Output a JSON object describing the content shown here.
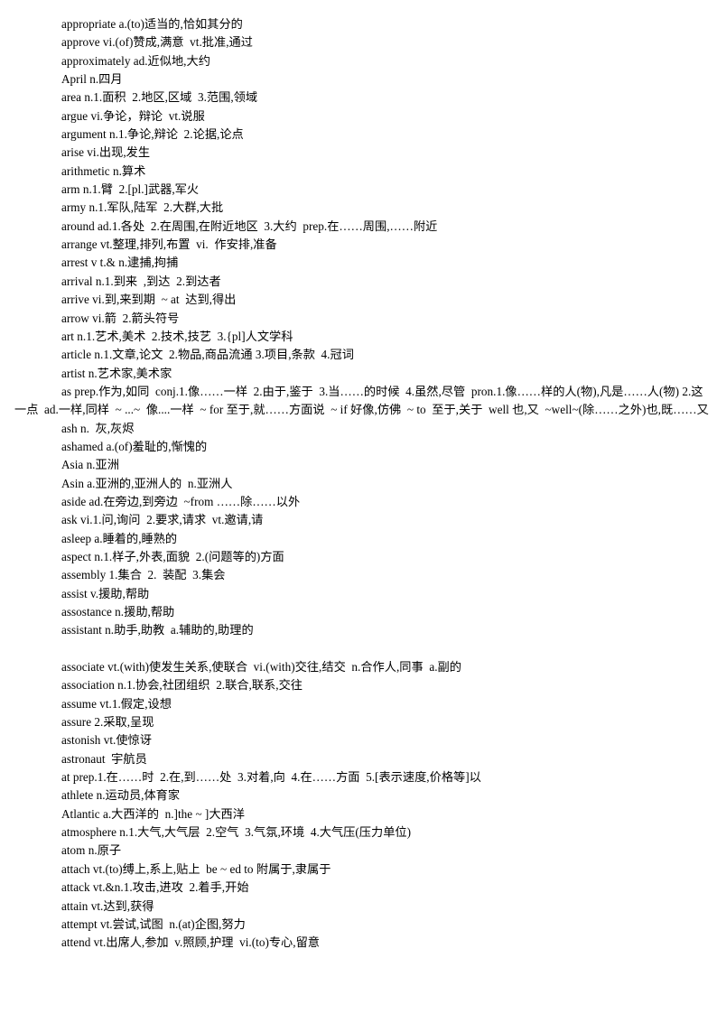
{
  "document": {
    "kind": "vocabulary-glossary-page",
    "language_pair": "English-Chinese",
    "entries": [
      {
        "text": "appropriate a.(to)适当的,恰如其分的"
      },
      {
        "text": "approve vi.(of)赞成,满意  vt.批准,通过"
      },
      {
        "text": "approximately ad.近似地,大约"
      },
      {
        "text": "April n.四月"
      },
      {
        "text": "area n.1.面积  2.地区,区域  3.范围,领域"
      },
      {
        "text": "argue vi.争论，辩论  vt.说服"
      },
      {
        "text": "argument n.1.争论,辩论  2.论据,论点"
      },
      {
        "text": "arise vi.出现,发生"
      },
      {
        "text": "arithmetic n.算术"
      },
      {
        "text": "arm n.1.臂  2.[pl.]武器,军火"
      },
      {
        "text": "army n.1.军队,陆军  2.大群,大批"
      },
      {
        "text": "around ad.1.各处  2.在周围,在附近地区  3.大约  prep.在……周围,……附近"
      },
      {
        "text": "arrange vt.整理,排列,布置  vi.  作安排,准备"
      },
      {
        "text": "arrest v t.& n.逮捕,拘捕"
      },
      {
        "text": "arrival n.1.到来  ,到达  2.到达者"
      },
      {
        "text": "arrive vi.到,来到期  ~ at  达到,得出"
      },
      {
        "text": "arrow vi.箭  2.箭头符号"
      },
      {
        "text": "art n.1.艺术,美术  2.技术,技艺  3.{pl]人文学科"
      },
      {
        "text": "article n.1.文章,论文  2.物品,商品流通 3.项目,条款  4.冠词"
      },
      {
        "text": "artist n.艺术家,美术家"
      },
      {
        "text": "as prep.作为,如同  conj.1.像……一样  2.由于,鉴于  3.当……的时候  4.虽然,尽管  pron.1.像……样的人(物),凡是……人(物) 2.这一点  ad.一样,同样  ~ ...~  像....一样  ~ for 至于,就……方面说  ~ if 好像,仿佛  ~ to  至于,关于  well 也,又  ~well~(除……之外)也,既……又"
      },
      {
        "text": "ash n.  灰,灰烬"
      },
      {
        "text": "ashamed a.(of)羞耻的,惭愧的"
      },
      {
        "text": "Asia n.亚洲"
      },
      {
        "text": "Asin a.亚洲的,亚洲人的  n.亚洲人"
      },
      {
        "text": "aside ad.在旁边,到旁边  ~from ……除……以外"
      },
      {
        "text": "ask vi.1.问,询问  2.要求,请求  vt.邀请,请"
      },
      {
        "text": "asleep a.睡着的,睡熟的"
      },
      {
        "text": "aspect n.1.样子,外表,面貌  2.(问题等的)方面"
      },
      {
        "text": "assembly 1.集合  2.  装配  3.集会"
      },
      {
        "text": "assist v.援助,帮助"
      },
      {
        "text": "assostance n.援助,帮助"
      },
      {
        "text": "assistant n.助手,助教  a.辅助的,助理的",
        "gap_after": true
      },
      {
        "text": "associate vt.(with)使发生关系,使联合  vi.(with)交往,结交  n.合作人,同事  a.副的"
      },
      {
        "text": "association n.1.协会,社团组织  2.联合,联系,交往"
      },
      {
        "text": "assume vt.1.假定,设想"
      },
      {
        "text": "assure 2.采取,呈现"
      },
      {
        "text": "astonish vt.使惊讶"
      },
      {
        "text": "astronaut  宇航员"
      },
      {
        "text": "at prep.1.在……时  2.在,到……处  3.对着,向  4.在……方面  5.[表示速度,价格等]以"
      },
      {
        "text": "athlete n.运动员,体育家"
      },
      {
        "text": "Atlantic a.大西洋的  n.]the ~ ]大西洋"
      },
      {
        "text": "atmosphere n.1.大气,大气层  2.空气  3.气氛,环境  4.大气压(压力单位)"
      },
      {
        "text": "atom n.原子"
      },
      {
        "text": "attach vt.(to)缚上,系上,贴上  be ~ ed to 附属于,隶属于"
      },
      {
        "text": "attack vt.&n.1.攻击,进攻  2.着手,开始"
      },
      {
        "text": "attain vt.达到,获得"
      },
      {
        "text": "attempt vt.尝试,试图  n.(at)企图,努力"
      },
      {
        "text": "attend vt.出席人,参加  v.照顾,护理  vi.(to)专心,留意"
      }
    ]
  }
}
